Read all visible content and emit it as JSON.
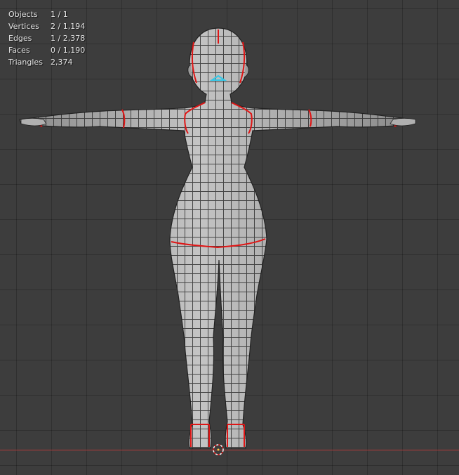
{
  "stats": [
    {
      "label": "Objects",
      "value": "1 / 1"
    },
    {
      "label": "Vertices",
      "value": "2 / 1,194"
    },
    {
      "label": "Edges",
      "value": "1 / 2,378"
    },
    {
      "label": "Faces",
      "value": "0 / 1,190"
    },
    {
      "label": "Triangles",
      "value": "2,374"
    }
  ],
  "colors": {
    "background": "#3d3d3d",
    "grid": "#2e2e2e",
    "mesh_fill": "#a9a9a9",
    "wire": "#1a1a1a",
    "seam": "#e01515",
    "selection": "#35c7e6",
    "x_axis": "#b33a3a"
  }
}
